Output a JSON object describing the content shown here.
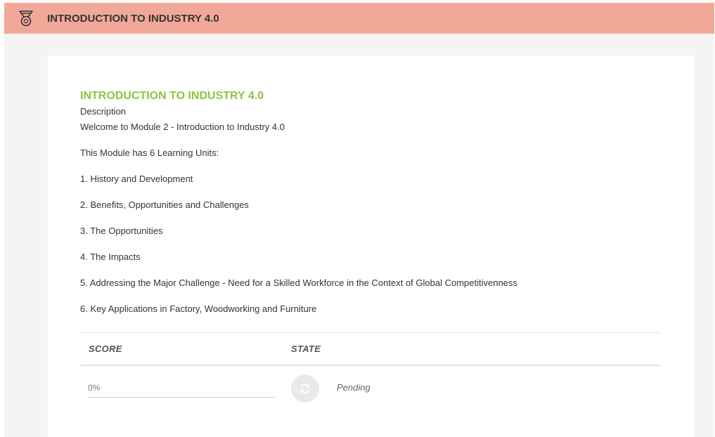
{
  "header": {
    "icon": "medal-icon",
    "title": "INTRODUCTION TO INDUSTRY 4.0"
  },
  "module": {
    "title": "INTRODUCTION TO INDUSTRY 4.0",
    "description_label": "Description",
    "welcome": "Welcome to Module 2 - Introduction to Industry 4.0",
    "intro": "This Module has 6 Learning Units:",
    "units": [
      "1. History and Development",
      "2. Benefits, Opportunities and Challenges",
      "3. The Opportunities",
      "4. The Impacts",
      "5. Addressing the Major Challenge - Need for a Skilled Workforce in the Context of Global Competitivenness",
      "6. Key Applications in Factory, Woodworking and Furniture"
    ]
  },
  "results": {
    "score_header": "SCORE",
    "state_header": "STATE",
    "score_value": "0%",
    "state_icon": "refresh-icon",
    "state_value": "Pending"
  },
  "colors": {
    "header_bg": "#f2a898",
    "title_green": "#8cc63f"
  }
}
